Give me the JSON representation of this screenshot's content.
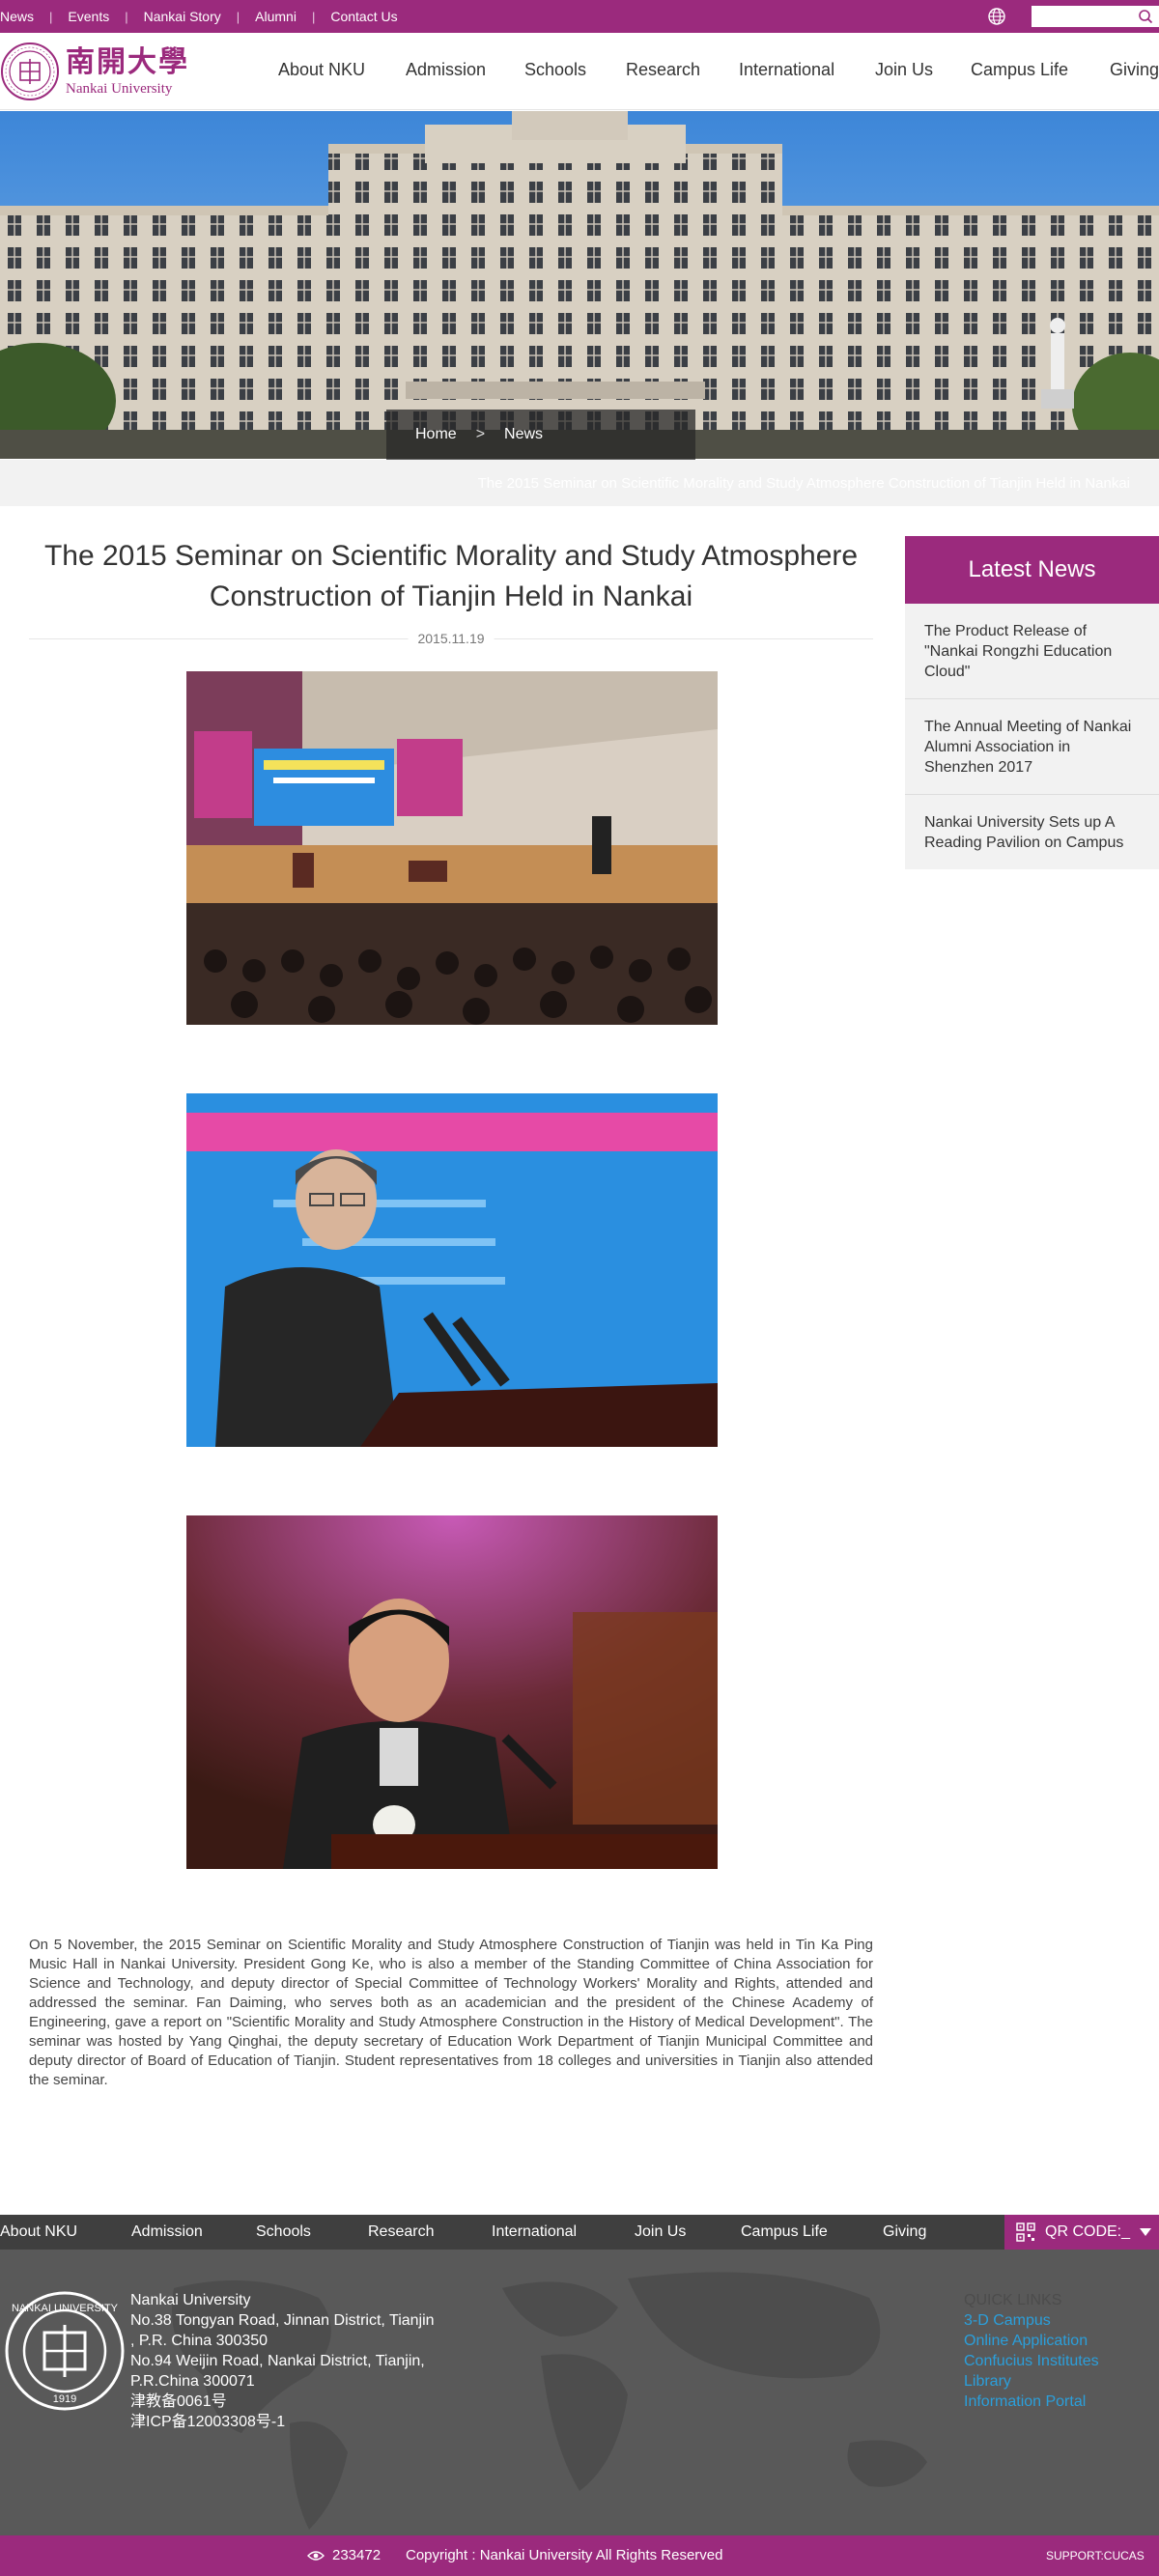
{
  "colors": {
    "brand": "#9b2a7d",
    "link": "#2b9fdb",
    "footer": "#595959"
  },
  "topbar": {
    "links": [
      "News",
      "Events",
      "Nankai Story",
      "Alumni",
      "Contact Us"
    ],
    "separator": "|",
    "search_placeholder": "",
    "icons": [
      "globe-icon",
      "search-icon"
    ]
  },
  "header": {
    "logo_cn": "南開大學",
    "logo_en": "Nankai University",
    "nav": [
      "About NKU",
      "Admission",
      "Schools",
      "Research",
      "International",
      "Join Us",
      "Campus Life",
      "Giving"
    ]
  },
  "breadcrumb": {
    "home": "Home",
    "separator": ">",
    "current": "News"
  },
  "subbar_title": "The 2015 Seminar on Scientific Morality and Study Atmosphere Construction of Tianjin Held in Nankai",
  "article": {
    "title": "The 2015 Seminar on Scientific Morality and Study Atmosphere Construction of Tianjin Held in Nankai",
    "date": "2015.11.19",
    "body": "On 5 November, the 2015 Seminar on Scientific Morality and Study Atmosphere Construction of Tianjin was held in Tin Ka Ping Music Hall in Nankai University. President Gong Ke, who is also a member of the Standing Committee of China Association for Science and Technology, and deputy director of Special Committee of Technology Workers' Morality and Rights, attended and addressed the seminar. Fan Daiming, who serves both as an academician and the president of the Chinese Academy of Engineering, gave a report on \"Scientific Morality and Study Atmosphere Construction in the History of Medical Development\". The seminar was hosted by Yang Qinghai, the deputy secretary of Education Work Department of Tianjin Municipal Committee and deputy director of Board of Education of Tianjin. Student representatives from 18 colleges and universities in Tianjin also attended the seminar."
  },
  "sidebar": {
    "heading": "Latest News",
    "items": [
      "The Product Release of \"Nankai Rongzhi Education Cloud\"",
      "The Annual Meeting of Nankai Alumni Association in Shenzhen 2017",
      "Nankai University Sets up A Reading Pavilion on Campus"
    ]
  },
  "footer": {
    "nav": [
      "About NKU",
      "Admission",
      "Schools",
      "Research",
      "International",
      "Join Us",
      "Campus Life",
      "Giving"
    ],
    "qr_label": "QR CODE:_",
    "address_lines": [
      "Nankai University",
      "No.38 Tongyan Road, Jinnan District, Tianjin",
      ", P.R. China 300350",
      "No.94 Weijin Road,  Nankai District, Tianjin,",
      "P.R.China  300071",
      "津教备0061号",
      "津ICP备12003308号-1"
    ],
    "quick_links_heading": "QUICK LINKS",
    "quick_links": [
      "3-D Campus",
      "Online Application",
      "Confucius Institutes",
      "Library",
      "Information Portal"
    ],
    "visits": "233472",
    "copyright": "Copyright : Nankai University All Rights Reserved",
    "support": "SUPPORT:CUCAS"
  }
}
